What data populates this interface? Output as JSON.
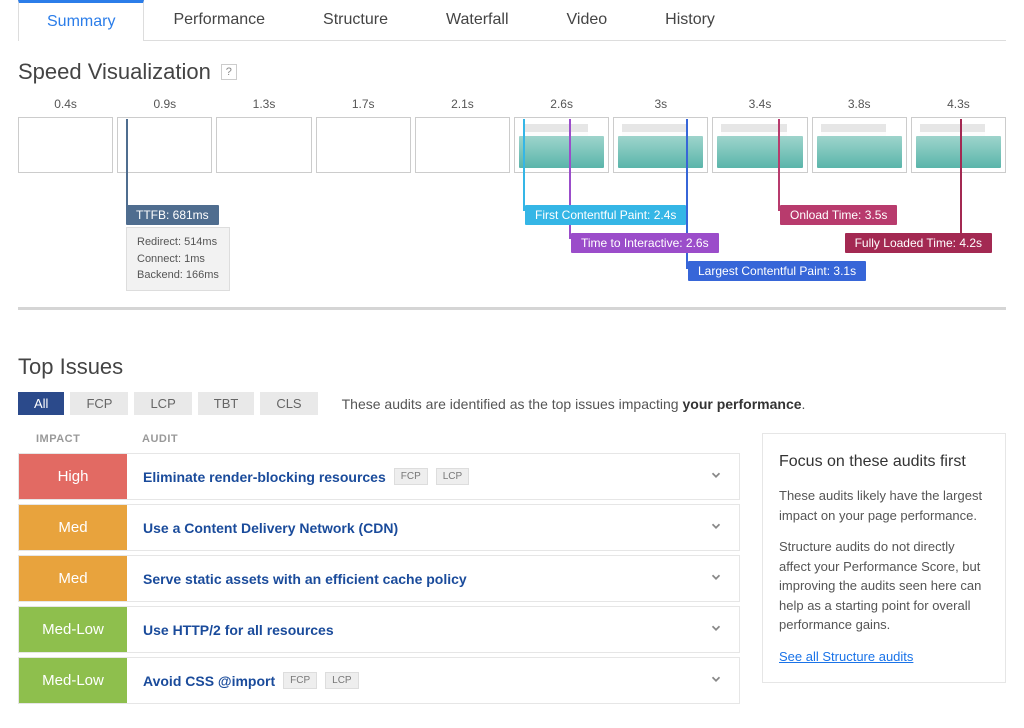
{
  "tabs": [
    {
      "label": "Summary",
      "active": true
    },
    {
      "label": "Performance"
    },
    {
      "label": "Structure"
    },
    {
      "label": "Waterfall"
    },
    {
      "label": "Video"
    },
    {
      "label": "History"
    }
  ],
  "speed_viz": {
    "title": "Speed Visualization",
    "timestamps": [
      "0.4s",
      "0.9s",
      "1.3s",
      "1.7s",
      "2.1s",
      "2.6s",
      "3s",
      "3.4s",
      "3.8s",
      "4.3s"
    ],
    "loaded_from_index": 5,
    "pills": {
      "ttfb": "TTFB: 681ms",
      "fcp": "First Contentful Paint: 2.4s",
      "tti": "Time to Interactive: 2.6s",
      "lcp": "Largest Contentful Paint: 3.1s",
      "onload": "Onload Time: 3.5s",
      "full": "Fully Loaded Time: 4.2s"
    },
    "ttfb_detail": {
      "redirect": "Redirect: 514ms",
      "connect": "Connect: 1ms",
      "backend": "Backend: 166ms"
    }
  },
  "top_issues": {
    "title": "Top Issues",
    "filters": [
      "All",
      "FCP",
      "LCP",
      "TBT",
      "CLS"
    ],
    "active_filter": "All",
    "desc_prefix": "These audits are identified as the top issues impacting ",
    "desc_bold": "your performance",
    "desc_suffix": ".",
    "header_impact": "IMPACT",
    "header_audit": "AUDIT",
    "rows": [
      {
        "impact": "High",
        "impact_class": "impact-high",
        "audit": "Eliminate render-blocking resources",
        "tags": [
          "FCP",
          "LCP"
        ]
      },
      {
        "impact": "Med",
        "impact_class": "impact-med",
        "audit": "Use a Content Delivery Network (CDN)",
        "tags": []
      },
      {
        "impact": "Med",
        "impact_class": "impact-med",
        "audit": "Serve static assets with an efficient cache policy",
        "tags": []
      },
      {
        "impact": "Med-Low",
        "impact_class": "impact-medlow",
        "audit": "Use HTTP/2 for all resources",
        "tags": []
      },
      {
        "impact": "Med-Low",
        "impact_class": "impact-medlow",
        "audit": "Avoid CSS @import",
        "tags": [
          "FCP",
          "LCP"
        ]
      }
    ],
    "focus": {
      "title": "Focus on these audits first",
      "p1": "These audits likely have the largest impact on your page performance.",
      "p2": "Structure audits do not directly affect your Performance Score, but improving the audits seen here can help as a starting point for overall performance gains.",
      "link": "See all Structure audits"
    }
  }
}
